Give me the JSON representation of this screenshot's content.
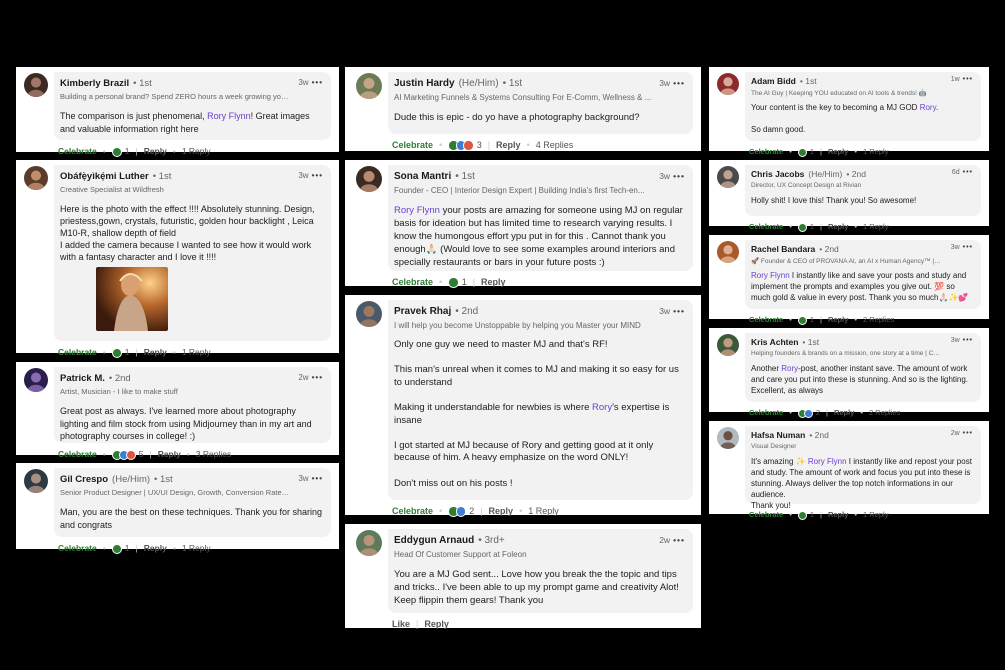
{
  "comments": [
    {
      "id": "kimberly",
      "name": "Kimberly Brazil",
      "degree": "1st",
      "headline": "Building a personal brand? Spend ZERO hours a week growing your b...",
      "time": "3w",
      "body": [
        [
          "The comparison is just phenomenal, ",
          {
            "m": "Rory Flynn"
          },
          "! Great images and valuable information right here"
        ]
      ],
      "celebrate": "Celebrate",
      "reactions": "1",
      "reply": "Reply",
      "replies": "1 Reply"
    },
    {
      "id": "obafeyikemi",
      "name": "Obáfẹ̀yìkẹ́mi Luther",
      "degree": "1st",
      "headline": "Creative Specialist at Wildfresh",
      "time": "3w",
      "body": [
        [
          "Here is the photo with the effect !!!! Absolutely stunning. Design, priestess,gown, crystals, futuristic, golden hour backlight , Leica M10-R, shallow depth of field"
        ],
        [
          "I added the camera because I wanted to see how it would work with a fantasy character and I love it !!!!"
        ]
      ],
      "celebrate": "Celebrate",
      "reactions": "1",
      "reply": "Reply",
      "replies": "1 Reply"
    },
    {
      "id": "patrick",
      "name": "Patrick M.",
      "degree": "2nd",
      "headline": "Artist, Musician - I like to make stuff",
      "time": "2w",
      "body": [
        [
          "Great post as always. I've learned more about photography lighting and film stock from using Midjourney than in my art and photography courses in college! :)"
        ]
      ],
      "celebrate": "Celebrate",
      "reactions": "5",
      "reply": "Reply",
      "replies": "3 Replies"
    },
    {
      "id": "gil",
      "name": "Gil Crespo",
      "pronouns": "(He/Him)",
      "degree": "1st",
      "headline": "Senior Product Designer | UX/UI Design, Growth, Conversion Rate Op...",
      "time": "3w",
      "body": [
        [
          "Man, you are the best on these techniques. Thank you for sharing and congrats"
        ]
      ],
      "celebrate": "Celebrate",
      "reactions": "1",
      "reply": "Reply",
      "replies": "1 Reply"
    },
    {
      "id": "justin",
      "name": "Justin Hardy",
      "pronouns": "(He/Him)",
      "degree": "1st",
      "headline": "AI Marketing Funnels & Systems Consulting For E-Comm, Wellness & ...",
      "time": "3w",
      "body": [
        [
          "Dude this is epic - do yo have a photography background?"
        ]
      ],
      "celebrate": "Celebrate",
      "reactions": "3",
      "reply": "Reply",
      "replies": "4 Replies"
    },
    {
      "id": "sona",
      "name": "Sona Mantri",
      "degree": "1st",
      "headline": "Founder - CEO | Interior Design Expert | Building India's first Tech-en...",
      "time": "3w",
      "body": [
        [
          {
            "m": "Rory Flynn"
          },
          " your posts are amazing for someone using MJ on regular basis for ideation but has limited time to research varying results. I know the humongous effort ypu put in for this . Cannot thank you enough🙏🏻 (Would love to see some examples around interiors and specially restaurants or bars in your future posts :)"
        ]
      ],
      "celebrate": "Celebrate",
      "reactions": "1",
      "reply": "Reply",
      "replies": ""
    },
    {
      "id": "pravek",
      "name": "Pravek Rhaj",
      "degree": "2nd",
      "headline": "I will help you become Unstoppable by helping you Master your MIND",
      "time": "3w",
      "body": [
        [
          "Only one guy we need to master MJ and that's RF!"
        ],
        [
          ""
        ],
        [
          "This man's unreal when it comes to MJ and making it so easy for us to understand"
        ],
        [
          ""
        ],
        [
          "Making it understandable for newbies is where ",
          {
            "m": "Rory"
          },
          "'s expertise is insane"
        ],
        [
          ""
        ],
        [
          "I got started at MJ because of Rory and getting good at it only because of him. A heavy emphasize on the word ONLY!"
        ],
        [
          ""
        ],
        [
          "Don't miss out on his posts !"
        ]
      ],
      "celebrate": "Celebrate",
      "reactions": "2",
      "reply": "Reply",
      "replies": "1 Reply"
    },
    {
      "id": "eddygun",
      "name": "Eddygun Arnaud",
      "degree": "3rd+",
      "headline": "Head Of Customer Support at Foleon",
      "time": "2w",
      "body": [
        [
          "You are a MJ God sent... Love how you break the the topic and tips and tricks.. I've been able to up my prompt game and creativity Alot! Keep flippin them gears! Thank you"
        ]
      ],
      "celebrate": "Like",
      "reactions": "",
      "reply": "Reply",
      "replies": ""
    },
    {
      "id": "adam",
      "name": "Adam Bidd",
      "degree": "1st",
      "headline": "The AI Guy | Keeping YOU educated on AI tools & trends! 🤖",
      "time": "1w",
      "body": [
        [
          "Your content is the key to becoming a MJ GOD ",
          {
            "m": "Rory"
          },
          "."
        ],
        [
          ""
        ],
        [
          "So damn good."
        ]
      ],
      "celebrate": "Celebrate",
      "reactions": "1",
      "reply": "Reply",
      "replies": "1 Reply"
    },
    {
      "id": "chris",
      "name": "Chris Jacobs",
      "pronouns": "(He/Him)",
      "degree": "2nd",
      "headline": "Director, UX Concept Design at Rivian",
      "time": "6d",
      "body": [
        [
          "Holly shit! I love this! Thank you! So awesome!"
        ]
      ],
      "celebrate": "Celebrate",
      "reactions": "1",
      "reply": "Reply",
      "replies": "1 Reply"
    },
    {
      "id": "rachel",
      "name": "Rachel Bandara",
      "degree": "2nd",
      "headline": "🚀 Founder & CEO of PROVANA AI, an AI x Human Agency™ | Helping ...",
      "time": "3w",
      "body": [
        [
          {
            "m": "Rory Flynn"
          },
          " I instantly like and save your posts and study and implement the prompts and examples you give out. 💯 so much gold & value in every post. Thank you so much🙏🏻✨💕"
        ]
      ],
      "celebrate": "Celebrate",
      "reactions": "1",
      "reply": "Reply",
      "replies": "2 Replies"
    },
    {
      "id": "kris",
      "name": "Kris Achten",
      "degree": "1st",
      "headline": "Helping founders & brands on a mission, one story at a time | Chief of...",
      "time": "3w",
      "body": [
        [
          "Another ",
          {
            "m": "Rory"
          },
          "-post, another instant save. The amount of work and care you put into these is stunning. And so is the lighting. Excellent, as always"
        ]
      ],
      "celebrate": "Celebrate",
      "reactions": "2",
      "reply": "Reply",
      "replies": "2 Replies"
    },
    {
      "id": "hafsa",
      "name": "Hafsa Numan",
      "degree": "2nd",
      "headline": "Visual Designer",
      "time": "2w",
      "body": [
        [
          "It's amazing ✨ ",
          {
            "m": "Rory Flynn"
          },
          " I instantly like and repost your post and study. The amount of work and focus you put into these is stunning. Always deliver the top notch informations in our audience."
        ],
        [
          "Thank you!"
        ]
      ],
      "celebrate": "Celebrate",
      "reactions": "1",
      "reply": "Reply",
      "replies": "1 Reply"
    }
  ],
  "colors": {
    "mention": "#6b3fd0",
    "celebrate": "#2e7d32",
    "bubble": "#f2f2f2",
    "background": "#000000"
  },
  "icons": {
    "more": "more-options-icon",
    "reaction": "reaction-icons"
  }
}
